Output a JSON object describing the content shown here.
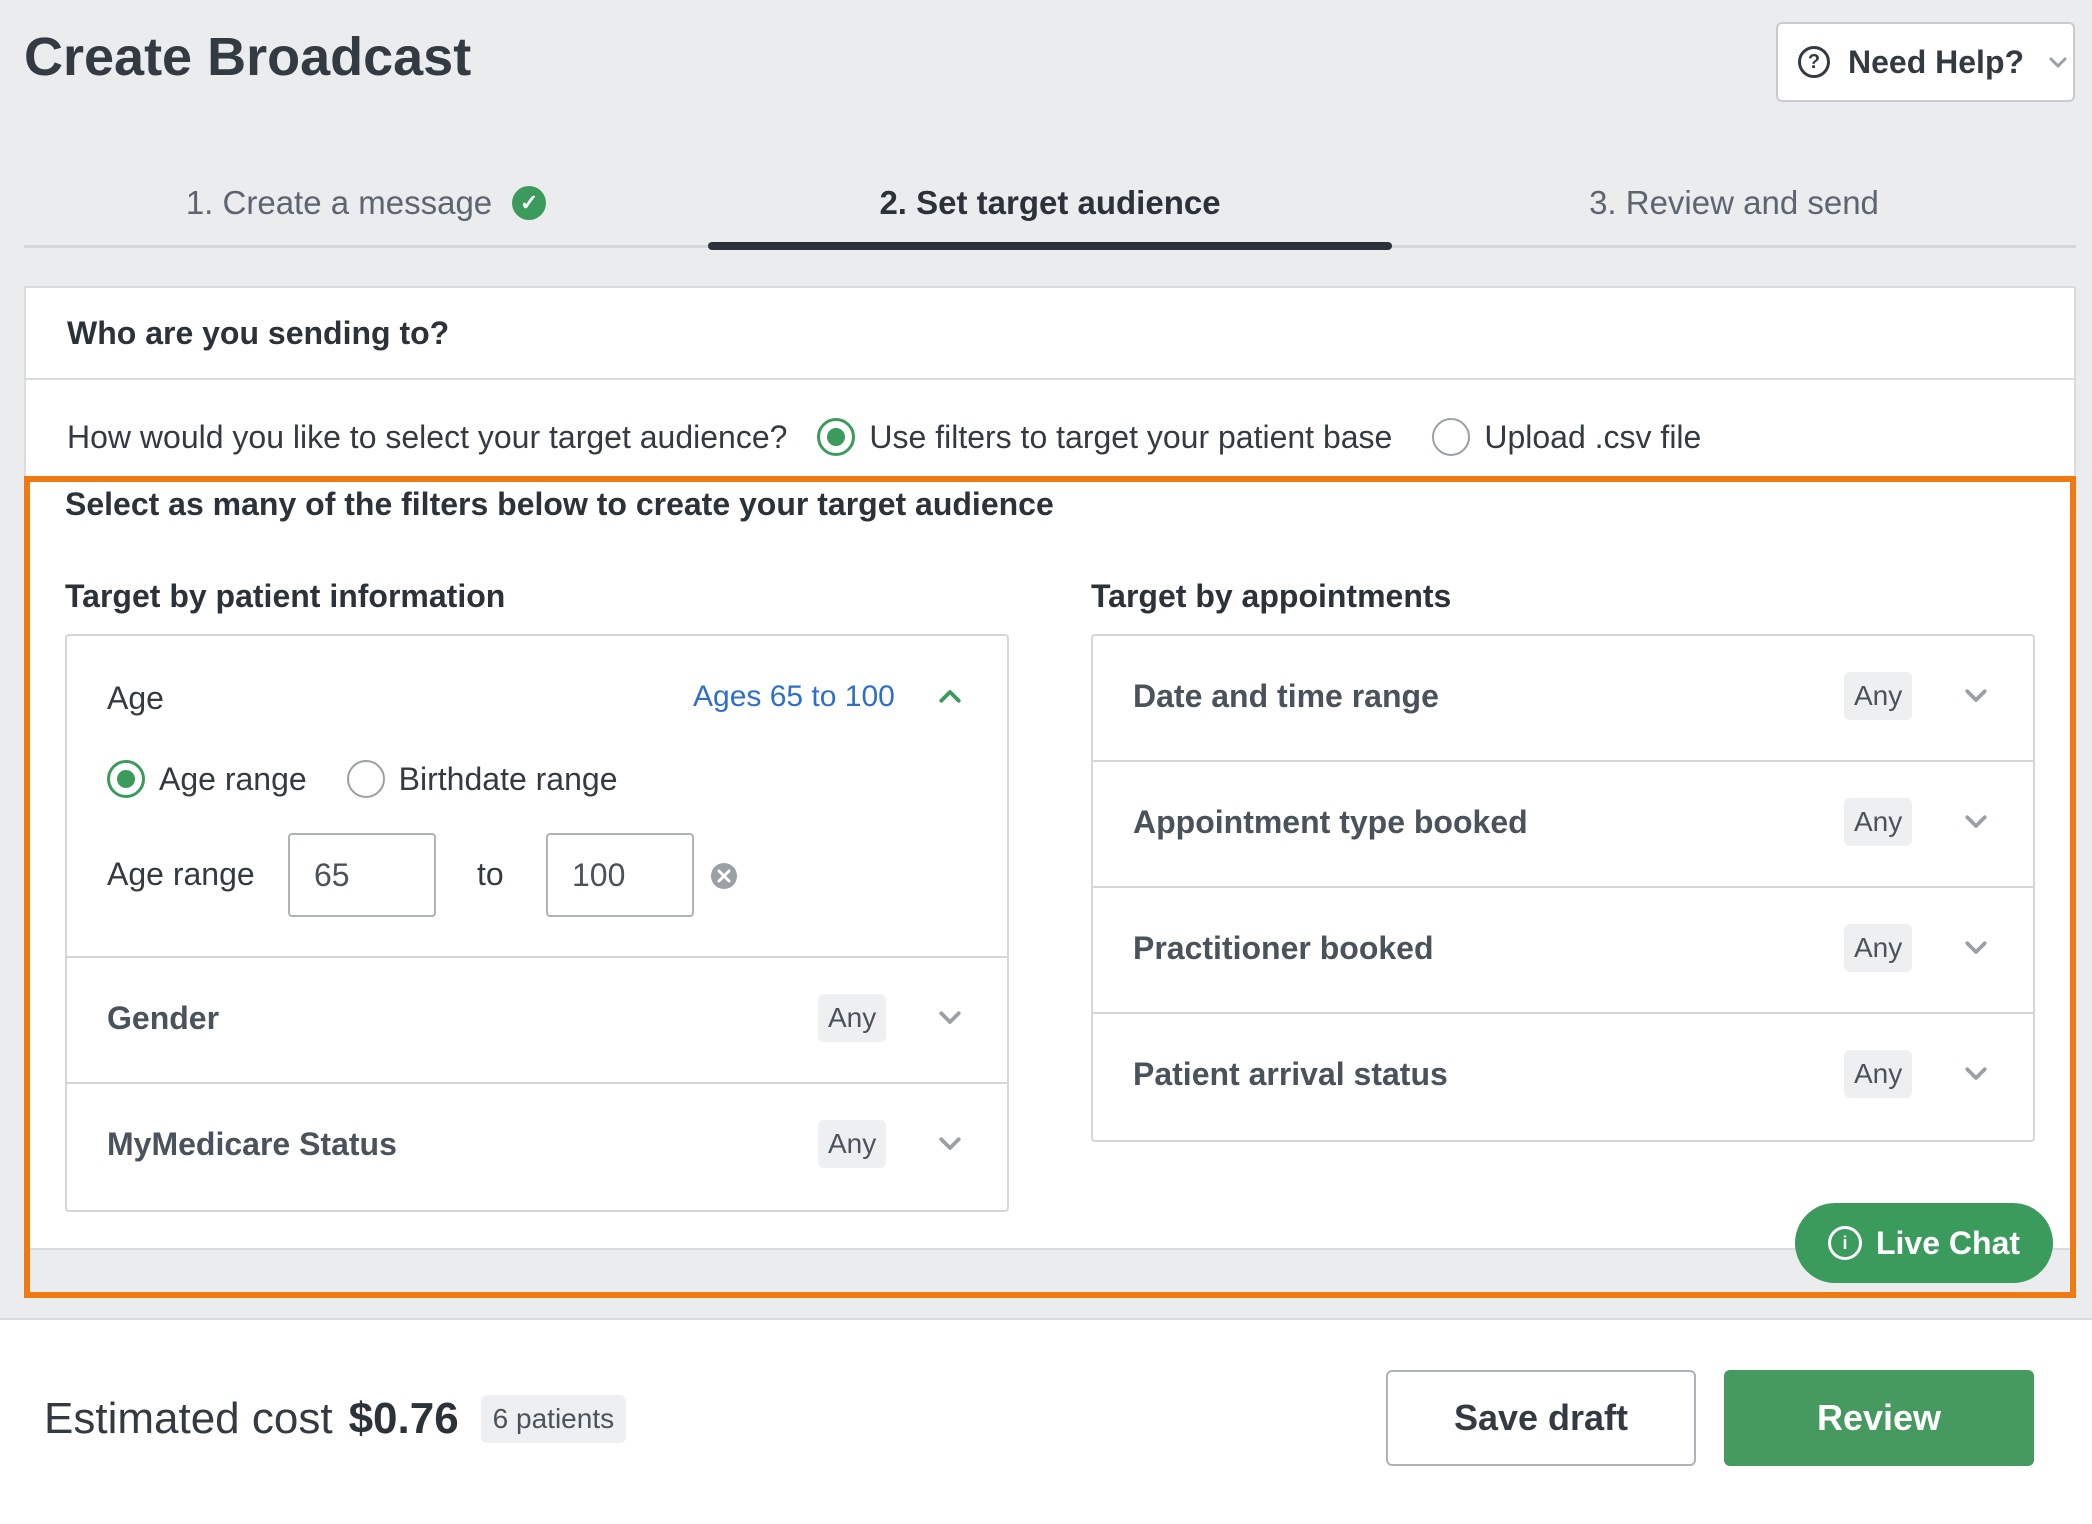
{
  "page": {
    "title": "Create Broadcast"
  },
  "help": {
    "label": "Need Help?"
  },
  "tabs": [
    {
      "label": "1. Create a message",
      "completed": true
    },
    {
      "label": "2. Set target audience",
      "active": true
    },
    {
      "label": "3. Review and send"
    }
  ],
  "audience": {
    "heading": "Who are you sending to?",
    "question": "How would you like to select your target audience?",
    "options": [
      {
        "label": "Use filters to target your patient base",
        "selected": true
      },
      {
        "label": "Upload .csv file",
        "selected": false
      }
    ],
    "filters_note": "Select as many of the filters below to create your target audience"
  },
  "patient_info": {
    "title": "Target by patient information",
    "age": {
      "label": "Age",
      "summary": "Ages 65 to 100",
      "mode_options": [
        {
          "label": "Age range",
          "selected": true
        },
        {
          "label": "Birthdate range",
          "selected": false
        }
      ],
      "range_label": "Age range",
      "from": "65",
      "to_label": "to",
      "to": "100"
    },
    "gender": {
      "label": "Gender",
      "value": "Any"
    },
    "mymedicare": {
      "label": "MyMedicare Status",
      "value": "Any"
    }
  },
  "appointments": {
    "title": "Target by appointments",
    "rows": [
      {
        "label": "Date and time range",
        "value": "Any"
      },
      {
        "label": "Appointment type booked",
        "value": "Any"
      },
      {
        "label": "Practitioner booked",
        "value": "Any"
      },
      {
        "label": "Patient arrival status",
        "value": "Any"
      }
    ]
  },
  "live_chat": {
    "label": "Live Chat"
  },
  "footer": {
    "cost_label": "Estimated cost",
    "cost_value": "$0.76",
    "patients": "6 patients",
    "save_label": "Save draft",
    "review_label": "Review"
  },
  "colors": {
    "accent_green": "#3a9b5c",
    "highlight_orange": "#f07a12",
    "link_blue": "#2f6fc7"
  }
}
